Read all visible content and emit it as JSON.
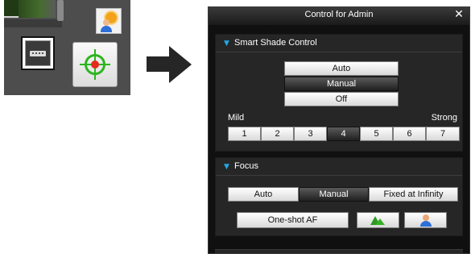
{
  "panel": {
    "title": "Control for Admin",
    "close_glyph": "✕"
  },
  "smart_shade": {
    "title": "Smart Shade Control",
    "modes": [
      "Auto",
      "Manual",
      "Off"
    ],
    "selected_mode": "Manual",
    "level_min_label": "Mild",
    "level_max_label": "Strong",
    "levels": [
      "1",
      "2",
      "3",
      "4",
      "5",
      "6",
      "7"
    ],
    "selected_level": "4"
  },
  "focus": {
    "title": "Focus",
    "modes": [
      "Auto",
      "Manual",
      "Fixed at Infinity"
    ],
    "selected_mode": "Manual",
    "oneshot_label": "One-shot AF",
    "far_icon": "mountain-icon",
    "near_icon": "person-icon"
  },
  "toolbar_crop": {
    "icons": [
      "scene-preview",
      "sunlight-person-icon",
      "settings-icon",
      "autofocus-target-icon"
    ]
  },
  "colors": {
    "accent": "#20a8e6",
    "panel_bg": "#262626",
    "selected_button": "#202020"
  }
}
